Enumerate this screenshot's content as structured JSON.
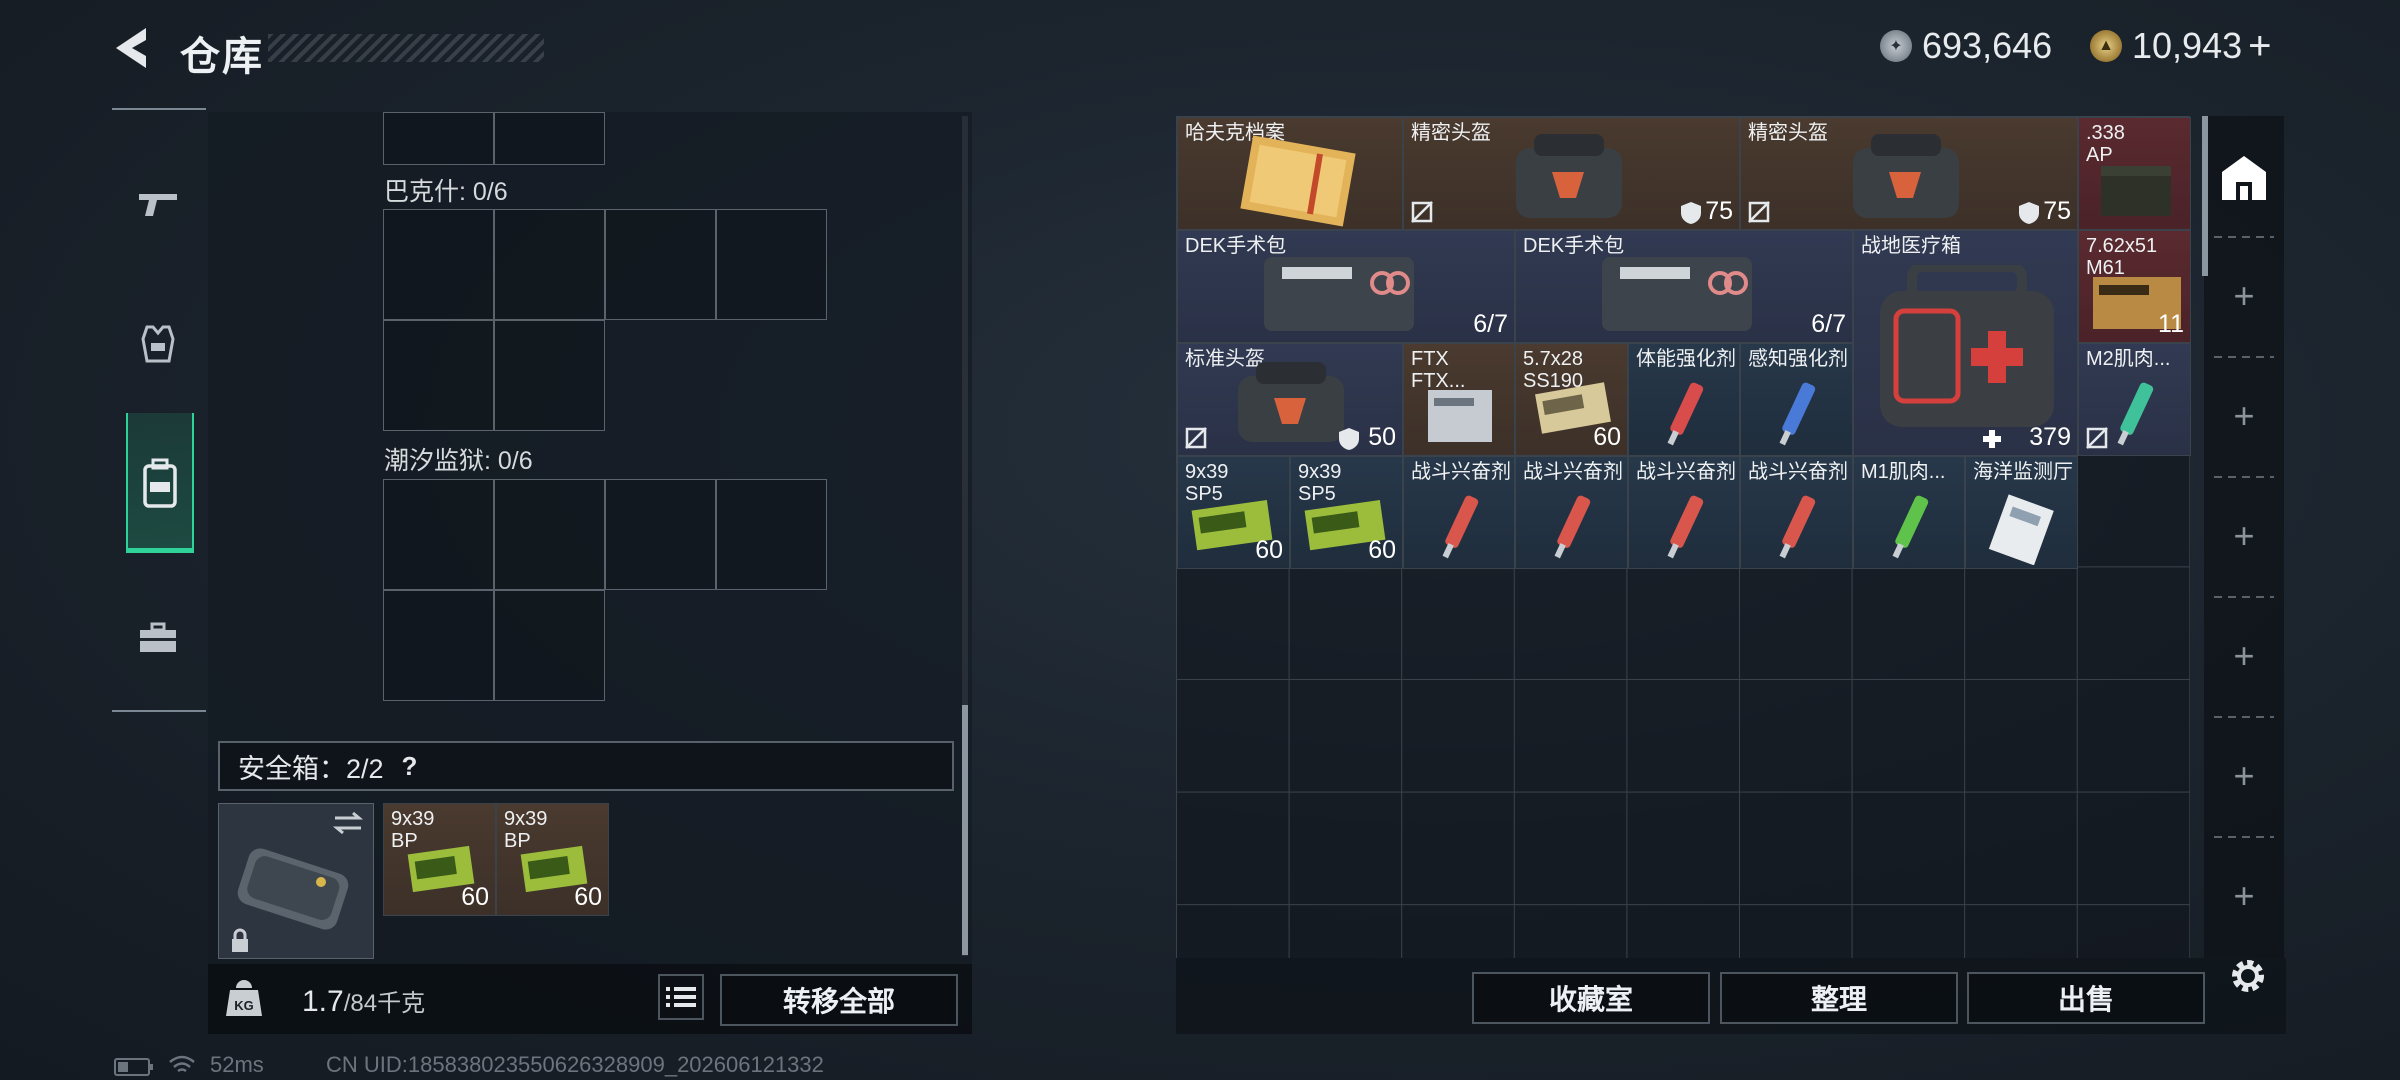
{
  "header": {
    "title": "仓库"
  },
  "currency": {
    "silver": "693,646",
    "gold": "10,943",
    "plus": "+"
  },
  "left": {
    "sections": [
      {
        "label": "巴克什: 0/6"
      },
      {
        "label": "潮汐监狱: 0/6"
      }
    ],
    "safebox": {
      "label": "安全箱：2/2",
      "help": "?"
    },
    "safe_items": [
      {
        "name": "9x39\nBP",
        "count": "60"
      },
      {
        "name": "9x39\nBP",
        "count": "60"
      }
    ],
    "weight": {
      "value": "1.7",
      "unit": "/84千克"
    },
    "transfer_all": "转移全部"
  },
  "items": [
    {
      "name": "哈夫克档案",
      "count": ""
    },
    {
      "name": "精密头盔",
      "count": "75"
    },
    {
      "name": "精密头盔",
      "count": "75"
    },
    {
      "name": ".338\nAP",
      "count": ""
    },
    {
      "name": "DEK手术包",
      "count": "6/7"
    },
    {
      "name": "DEK手术包",
      "count": "6/7"
    },
    {
      "name": "战地医疗箱",
      "count": "379"
    },
    {
      "name": "7.62x51\nM61",
      "count": "11"
    },
    {
      "name": "标准头盔",
      "count": "50"
    },
    {
      "name": "FTX\nFTX...",
      "count": ""
    },
    {
      "name": "5.7x28\nSS190",
      "count": "60"
    },
    {
      "name": "体能强化剂",
      "count": ""
    },
    {
      "name": "感知强化剂",
      "count": ""
    },
    {
      "name": "M2肌肉...",
      "count": ""
    },
    {
      "name": "9x39\nSP5",
      "count": "60"
    },
    {
      "name": "9x39\nSP5",
      "count": "60"
    },
    {
      "name": "战斗兴奋剂",
      "count": ""
    },
    {
      "name": "战斗兴奋剂",
      "count": ""
    },
    {
      "name": "战斗兴奋剂",
      "count": ""
    },
    {
      "name": "战斗兴奋剂",
      "count": ""
    },
    {
      "name": "M1肌肉...",
      "count": ""
    },
    {
      "name": "海洋监测厅",
      "count": ""
    }
  ],
  "buttons": {
    "collection": "收藏室",
    "sort": "整理",
    "sell": "出售"
  },
  "status": {
    "ping": "52ms",
    "uid": "CN UID:185838023550626328909_202606121332"
  },
  "icons": [
    "back-icon",
    "gun-icon",
    "armor-icon",
    "backpack-icon",
    "toolbox-icon",
    "home-stash-icon",
    "add-icon",
    "gear-icon",
    "kg-icon",
    "list-icon",
    "swap-icon",
    "lock-icon",
    "shield-icon",
    "no-insure-icon",
    "heal-icon",
    "battery-icon",
    "wifi-icon"
  ]
}
